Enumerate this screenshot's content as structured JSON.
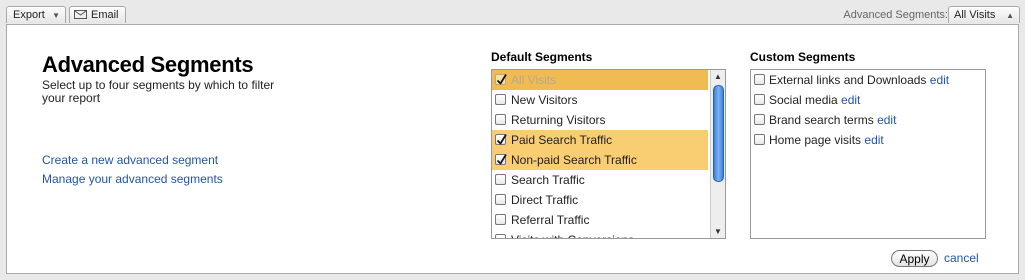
{
  "toolbar": {
    "export_label": "Export",
    "email_label": "Email",
    "segments_label": "Advanced Segments:",
    "segments_value": "All Visits"
  },
  "panel": {
    "title": "Advanced Segments",
    "subtitle": "Select up to four segments by which to filter your report",
    "create_link": "Create a new advanced segment",
    "manage_link": "Manage your advanced segments"
  },
  "default_segments": {
    "heading": "Default Segments",
    "items": [
      {
        "label": "All Visits",
        "checked": true,
        "disabled": true
      },
      {
        "label": "New Visitors",
        "checked": false
      },
      {
        "label": "Returning Visitors",
        "checked": false
      },
      {
        "label": "Paid Search Traffic",
        "checked": true
      },
      {
        "label": "Non-paid Search Traffic",
        "checked": true
      },
      {
        "label": "Search Traffic",
        "checked": false
      },
      {
        "label": "Direct Traffic",
        "checked": false
      },
      {
        "label": "Referral Traffic",
        "checked": false
      },
      {
        "label": "Visits with Conversions",
        "checked": false
      }
    ]
  },
  "custom_segments": {
    "heading": "Custom Segments",
    "edit_label": "edit",
    "items": [
      {
        "label": "External links and Downloads",
        "checked": false
      },
      {
        "label": "Social media",
        "checked": false
      },
      {
        "label": "Brand search terms",
        "checked": false
      },
      {
        "label": "Home page visits",
        "checked": false
      }
    ]
  },
  "actions": {
    "apply_label": "Apply",
    "cancel_label": "cancel"
  },
  "colors": {
    "selected_row": "#f9cd72",
    "link": "#2255a4",
    "scroll_thumb": "#3d7fd8"
  }
}
